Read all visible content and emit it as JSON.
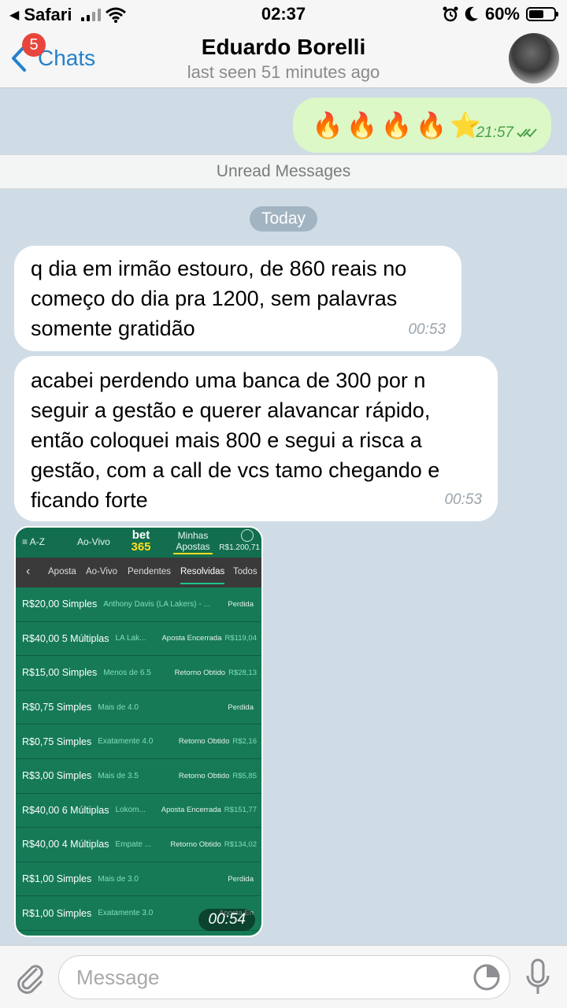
{
  "status_bar": {
    "back_app": "Safari",
    "time": "02:37",
    "battery": "60%",
    "battery_level": 0.6
  },
  "header": {
    "back_label": "Chats",
    "unread_badge": "5",
    "title": "Eduardo Borelli",
    "subtitle": "last seen 51 minutes ago"
  },
  "messages": {
    "outgoing": {
      "emojis": "🔥🔥🔥🔥⭐",
      "time": "21:57"
    },
    "unread_label": "Unread Messages",
    "date_label": "Today",
    "incoming": [
      {
        "text": "q dia em irmão estouro, de 860 reais no começo do dia pra 1200, sem palavras somente gratidão",
        "time": "00:53"
      },
      {
        "text": "acabei perdendo uma banca de 300 por n seguir a gestão e querer alavancar rápido, então coloquei mais 800 e segui a risca a gestão, com a call de vcs tamo chegando e ficando forte",
        "time": "00:53"
      }
    ],
    "image_time": "00:54"
  },
  "bet365": {
    "nav": {
      "az": "≡ A-Z",
      "ao_vivo": "Ao-Vivo",
      "logo_top": "bet",
      "logo_bottom": "365",
      "minhas": "Minhas Apostas",
      "balance": "R$1.200,71"
    },
    "tabs": [
      "Aposta",
      "Ao-Vivo",
      "Pendentes",
      "Resolvidas",
      "Todos"
    ],
    "active_tab": "Resolvidas",
    "rows": [
      {
        "stake": "R$20,00 Simples",
        "selection": "Anthony Davis (LA Lakers) - ...",
        "result": "Perdida",
        "amount": ""
      },
      {
        "stake": "R$40,00 5 Múltiplas",
        "selection": "LA Lak...",
        "result": "Aposta Encerrada",
        "amount": "R$119,04"
      },
      {
        "stake": "R$15,00 Simples",
        "selection": "Menos de 6.5",
        "result": "Retorno Obtido",
        "amount": "R$28,13"
      },
      {
        "stake": "R$0,75 Simples",
        "selection": "Mais de 4.0",
        "result": "Perdida",
        "amount": ""
      },
      {
        "stake": "R$0,75 Simples",
        "selection": "Exatamente 4.0",
        "result": "Retorno Obtido",
        "amount": "R$2,16"
      },
      {
        "stake": "R$3,00 Simples",
        "selection": "Mais de 3.5",
        "result": "Retorno Obtido",
        "amount": "R$5,85"
      },
      {
        "stake": "R$40,00 6 Múltiplas",
        "selection": "Lokom...",
        "result": "Aposta Encerrada",
        "amount": "R$151,77"
      },
      {
        "stake": "R$40,00 4 Múltiplas",
        "selection": "Empate ...",
        "result": "Retorno Obtido",
        "amount": "R$134,02"
      },
      {
        "stake": "R$1,00 Simples",
        "selection": "Mais de 3.0",
        "result": "Perdida",
        "amount": ""
      },
      {
        "stake": "R$1,00 Simples",
        "selection": "Exatamente 3.0",
        "result": "Aposta En",
        "amount": ""
      }
    ]
  },
  "input": {
    "placeholder": "Message"
  }
}
